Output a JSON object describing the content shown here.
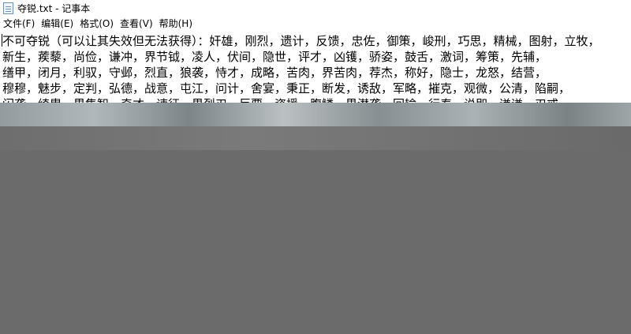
{
  "window": {
    "title": "夺锐.txt - 记事本",
    "icon": "notepad-icon"
  },
  "menu": {
    "items": [
      "文件(F)",
      "编辑(E)",
      "格式(O)",
      "查看(V)",
      "帮助(H)"
    ]
  },
  "document": {
    "lines": [
      "不可夺锐（可以让其失效但无法获得）：奸雄，刚烈，遗计，反馈，忠佐，御策，峻刑，巧思，精械，图射，立牧，",
      "新生，蒺藜，尚俭，谦冲，界节钺，凌人，伏间，隐世，评才，凶镬，骄姿，鼓舌，激词，筹策，先辅，",
      "缮甲，闭月，利驭，守邺，烈直，狼袭，恃才，成略，苦肉，界苦肉，荐杰，称好，隐士，龙怒，结营，",
      "穆穆，魅步，定判，弘德，战意，屯江，问计，舍宴，秉正，断发，诱敌，军略，摧克，观微，公清，陷嗣，",
      "闪袭，绮胄，界集智，奇才，谏征，界烈刃，巨贾，资援，腹鳞，界潜袭，回输，行泰，说即，谦谦，刃戒"
    ]
  },
  "colors": {
    "overlay": "#6b6b6b",
    "text": "#000000",
    "background": "#ffffff"
  }
}
